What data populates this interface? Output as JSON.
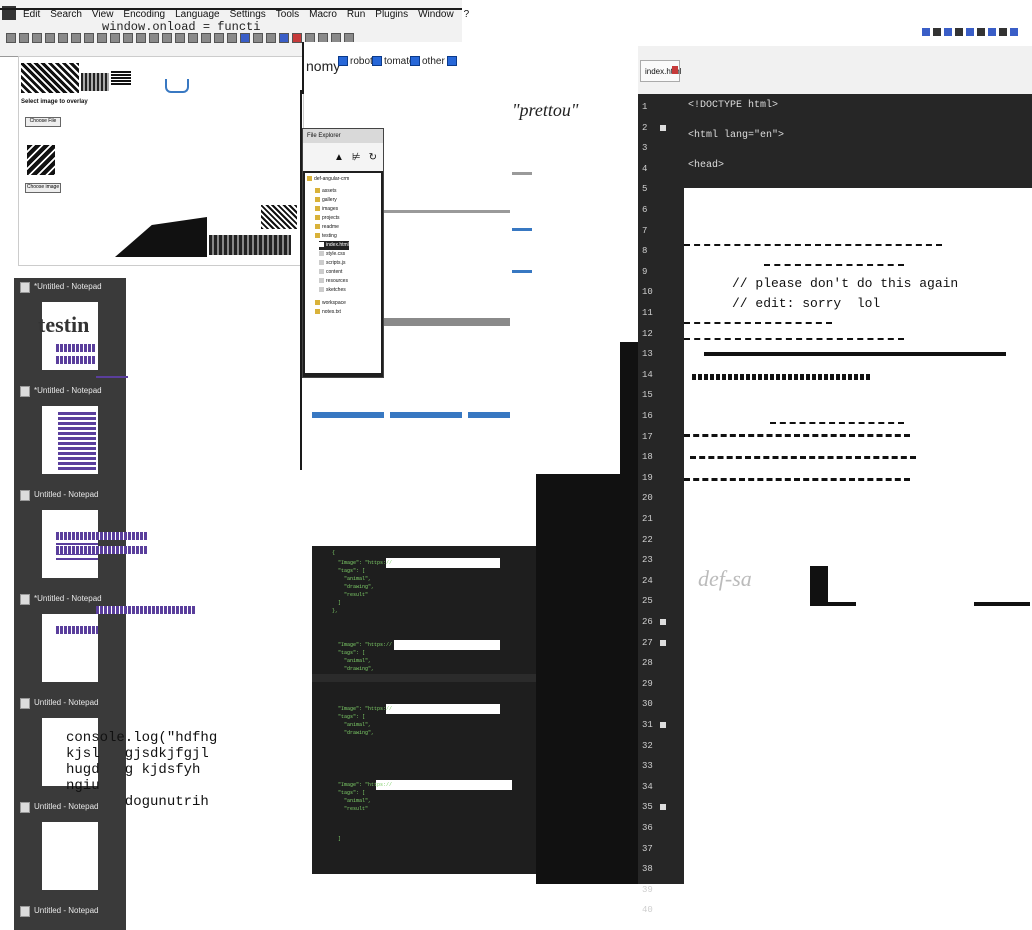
{
  "menubar": {
    "items": [
      "Edit",
      "Search",
      "View",
      "Encoding",
      "Language",
      "Settings",
      "Tools",
      "Macro",
      "Run",
      "Plugins",
      "Window",
      "?"
    ]
  },
  "image_pane": {
    "title": "window.onload = functi",
    "select_label": "Select image to overlay",
    "choose_button": "Choose File",
    "choose_button_2": "Choose image"
  },
  "form_strip": {
    "label_start": "nomy",
    "option_1": "robot",
    "option_2": "tomato",
    "option_3": "other"
  },
  "browser": {
    "text": "\"prettou\""
  },
  "explorer": {
    "title": "File Explorer",
    "root": "def-angular-crm",
    "items": [
      "assets",
      "gallery",
      "images",
      "projects",
      "readme",
      "testing",
      "index.html",
      "style.css",
      "scripts.js",
      "content",
      "resources",
      "sketches",
      "workspace",
      "notes.txt"
    ],
    "selected_index": 6
  },
  "notepads": [
    {
      "title": "*Untitled - Notepad"
    },
    {
      "title": "*Untitled - Notepad"
    },
    {
      "title": "Untitled - Notepad"
    },
    {
      "title": "*Untitled - Notepad"
    },
    {
      "title": "Untitled - Notepad"
    },
    {
      "title": "Untitled - Notepad"
    },
    {
      "title": "Untitled - Notepad"
    }
  ],
  "notepad_preview": {
    "testing": "testin",
    "console_lines": "console.log(\"hdfhg\nkjsl   gjsdkjfgjl\nhugd   g kjdsfyh\nngiu\n       dogunutrih"
  },
  "json_window": {
    "keys": [
      "{",
      "  \"Image\": \"https://",
      "  \"tags\": [",
      "    \"animal\",",
      "    \"drawing\",",
      "    \"result\"",
      "  ]",
      "},"
    ]
  },
  "editor": {
    "tab_label": "index.html",
    "lines": [
      "<!DOCTYPE html>",
      "<html lang=\"en\">",
      "<head>"
    ],
    "comment_1": "// please don't do this again",
    "comment_2": "// edit: sorry  lol",
    "line_numbers": [
      "1",
      "2",
      "3",
      "4",
      "5",
      "6",
      "7",
      "8",
      "9",
      "10",
      "11",
      "12",
      "13",
      "14",
      "15",
      "16",
      "17",
      "18",
      "19",
      "20",
      "21",
      "22",
      "23",
      "24",
      "25",
      "26",
      "27",
      "28",
      "29",
      "30",
      "31",
      "32",
      "33",
      "34",
      "35",
      "36",
      "37",
      "38",
      "39",
      "40"
    ],
    "signature": "def-sa"
  },
  "colors": {
    "accent": "#3a5ec7",
    "json_green": "#7fd069",
    "purple": "#5a3e9c"
  }
}
